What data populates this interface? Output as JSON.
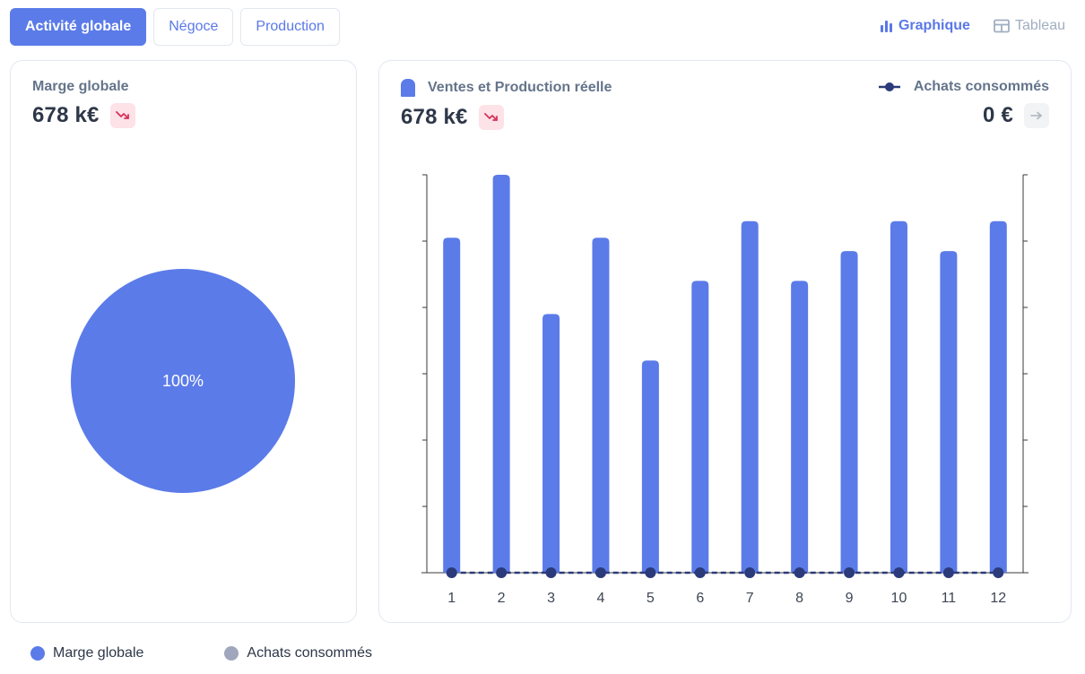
{
  "tabs": [
    {
      "label": "Activité globale",
      "active": true
    },
    {
      "label": "Négoce",
      "active": false
    },
    {
      "label": "Production",
      "active": false
    }
  ],
  "view_toggle": {
    "chart_label": "Graphique",
    "table_label": "Tableau",
    "active": "chart"
  },
  "left_card": {
    "label": "Marge globale",
    "value": "678 k€",
    "trend": "down",
    "pie_label": "100%"
  },
  "right_card": {
    "primary_label": "Ventes et Production réelle",
    "primary_value": "678 k€",
    "primary_trend": "down",
    "secondary_label": "Achats consommés",
    "secondary_value": "0 €",
    "secondary_trend": "flat"
  },
  "legend": [
    {
      "label": "Marge globale",
      "color": "#5b7be9"
    },
    {
      "label": "Achats consommés",
      "color": "#a0a6bc"
    }
  ],
  "colors": {
    "accent": "#5b7be9",
    "line": "#2b3a7a",
    "trend_down": "#d6335a",
    "trend_flat": "#adb5bd"
  },
  "chart_data": [
    {
      "type": "pie",
      "categories": [
        "Marge globale"
      ],
      "values": [
        100
      ],
      "labels": [
        "100%"
      ]
    },
    {
      "type": "bar",
      "categories": [
        "1",
        "2",
        "3",
        "4",
        "5",
        "6",
        "7",
        "8",
        "9",
        "10",
        "11",
        "12"
      ],
      "series": [
        {
          "name": "Ventes et Production réelle",
          "type": "bar",
          "values": [
            5.05,
            6.0,
            3.9,
            5.05,
            3.2,
            4.4,
            5.3,
            4.4,
            4.85,
            5.3,
            4.85,
            5.3
          ]
        },
        {
          "name": "Achats consommés",
          "type": "line",
          "values": [
            0,
            0,
            0,
            0,
            0,
            0,
            0,
            0,
            0,
            0,
            0,
            0
          ]
        }
      ],
      "ylim": [
        0,
        6
      ],
      "grid": false
    }
  ]
}
